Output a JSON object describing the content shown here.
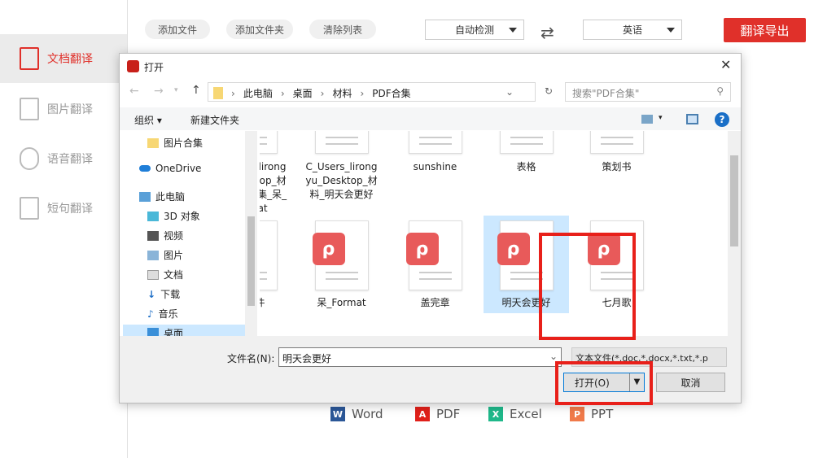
{
  "sidebar": {
    "items": [
      {
        "label": "文档翻译",
        "icon": "document-icon",
        "active": true
      },
      {
        "label": "图片翻译",
        "icon": "image-icon"
      },
      {
        "label": "语音翻译",
        "icon": "microphone-icon"
      },
      {
        "label": "短句翻译",
        "icon": "text-icon"
      }
    ]
  },
  "toolbar": {
    "add_file": "添加文件",
    "add_folder": "添加文件夹",
    "clear_list": "清除列表",
    "source_lang": "自动检测",
    "target_lang": "英语",
    "export": "翻译导出"
  },
  "formats": [
    "Word",
    "PDF",
    "Excel",
    "PPT"
  ],
  "dialog": {
    "title": "打开",
    "breadcrumb": [
      "此电脑",
      "桌面",
      "材料",
      "PDF合集"
    ],
    "search_placeholder": "搜索\"PDF合集\"",
    "organize": "组织 ▾",
    "new_folder": "新建文件夹",
    "nav": [
      {
        "label": "图片合集",
        "icon": "folder-icon"
      },
      {
        "label": "OneDrive",
        "icon": "cloud-icon"
      },
      {
        "label": "此电脑",
        "icon": "computer-icon"
      },
      {
        "label": "3D 对象",
        "icon": "cube-icon"
      },
      {
        "label": "视频",
        "icon": "video-icon"
      },
      {
        "label": "图片",
        "icon": "picture-icon"
      },
      {
        "label": "文档",
        "icon": "document-icon"
      },
      {
        "label": "下载",
        "icon": "download-icon"
      },
      {
        "label": "音乐",
        "icon": "music-icon"
      },
      {
        "label": "桌面",
        "icon": "desktop-icon"
      }
    ],
    "files_row1": [
      "C_Users_lirongyu_Desktop_材料_PDF合集_呆_Format",
      "C_Users_lirongyu_Desktop_材料_明天会更好",
      "sunshine",
      "表格",
      "策划书"
    ],
    "files_row2": [
      "大文件",
      "呆_Format",
      "盖完章",
      "明天会更好",
      "七月歌"
    ],
    "selected_file": "明天会更好",
    "filename_label": "文件名(N):",
    "filename_value": "明天会更好",
    "filetype": "文本文件(*.doc,*.docx,*.txt,*.p",
    "open": "打开(O)",
    "cancel": "取消"
  }
}
